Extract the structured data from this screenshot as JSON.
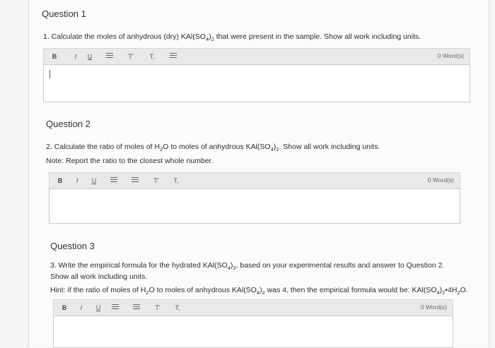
{
  "q1": {
    "title": "Question 1",
    "text_a": "1. Calculate the moles of anhydrous (dry) KAl(SO",
    "text_sub1": "4",
    "text_b": ")",
    "text_sub2": "2",
    "text_c": " that were present in the sample. Show all work including units.",
    "word_count": "0 Word(s)"
  },
  "q2": {
    "title": "Question 2",
    "text_a": "2. Calculate the ratio of moles of H",
    "text_sub1": "2",
    "text_b": "O to moles of anhydrous KAl(SO",
    "text_sub2": "4",
    "text_c": ")",
    "text_sub3": "2",
    "text_d": ". Show all work including units.",
    "note": "Note: Report the ratio to the closest whole number.",
    "word_count": "0 Word(s)"
  },
  "q3": {
    "title": "Question 3",
    "text_a": "3. Write the empirical formula for the hydrated KAl(SO",
    "text_sub1": "4",
    "text_b": ")",
    "text_sub2": "2",
    "text_c": ", based on your experimental results and answer to Question 2. Show all work including units.",
    "hint_a": "Hint: if the ratio of moles of H",
    "hint_sub1": "2",
    "hint_b": "O to moles of anhydrous KAl(SO",
    "hint_sub2": "4",
    "hint_c": ")",
    "hint_sub3": "2",
    "hint_d": " was 4, then the empirical formula would be: KAl(SO",
    "hint_sub4": "4",
    "hint_e": ")",
    "hint_sub5": "2",
    "hint_f": "•4H",
    "hint_sub6": "2",
    "hint_g": "O.",
    "word_count": "0 Word(s)"
  },
  "toolbar": {
    "bold": "B",
    "italic": "I",
    "underline": "U",
    "superscript": "T'",
    "subscript": "T,"
  }
}
